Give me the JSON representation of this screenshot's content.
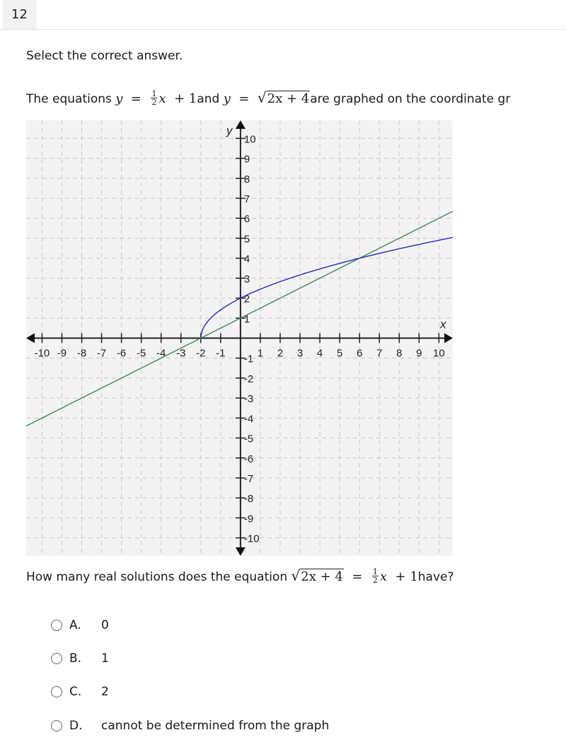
{
  "header": {
    "question_number": "12"
  },
  "instruction": "Select the correct answer.",
  "prompt": {
    "lead": "The equations",
    "eq1": {
      "lhs": "y",
      "equals": "=",
      "frac_num": "1",
      "frac_den": "2",
      "var": "x",
      "plus": "+",
      "const": "1"
    },
    "mid": "and",
    "eq2": {
      "lhs": "y",
      "equals": "=",
      "radicand": "2x + 4"
    },
    "tail": "are graphed on the coordinate gr"
  },
  "question": {
    "lead": "How many real solutions does the equation",
    "radicand": "2x + 4",
    "equals": "=",
    "frac_num": "1",
    "frac_den": "2",
    "var": "x",
    "plus": "+",
    "const": "1",
    "tail": "have?"
  },
  "choices": [
    {
      "letter": "A.",
      "text": "0",
      "selected": false
    },
    {
      "letter": "B.",
      "text": "1",
      "selected": false
    },
    {
      "letter": "C.",
      "text": "2",
      "selected": false
    },
    {
      "letter": "D.",
      "text": "cannot be determined from the graph",
      "selected": false
    }
  ],
  "chart_data": {
    "type": "line",
    "title": "",
    "xlabel": "x",
    "ylabel": "y",
    "xlim": [
      -10.8,
      10.7
    ],
    "ylim": [
      -10.9,
      10.9
    ],
    "grid": true,
    "x_ticks": [
      -10,
      -9,
      -8,
      -7,
      -6,
      -5,
      -4,
      -3,
      -2,
      -1,
      1,
      2,
      3,
      4,
      5,
      6,
      7,
      8,
      9,
      10
    ],
    "y_ticks": [
      -10,
      -9,
      -8,
      -7,
      -6,
      -5,
      -4,
      -3,
      -2,
      -1,
      1,
      2,
      3,
      4,
      5,
      6,
      7,
      8,
      9,
      10
    ],
    "series": [
      {
        "name": "y = 1/2 x + 1",
        "kind": "linear",
        "slope": 0.5,
        "intercept": 1,
        "domain": [
          -10.8,
          10.7
        ],
        "color": "#3e8a5a"
      },
      {
        "name": "y = sqrt(2x + 4)",
        "kind": "sqrt",
        "a": 2,
        "b": 4,
        "domain": [
          -2,
          10.7
        ],
        "color": "#2a2ab0"
      }
    ],
    "intersections": [
      {
        "x": -2,
        "y": 0
      },
      {
        "x": 6,
        "y": 4
      }
    ]
  }
}
